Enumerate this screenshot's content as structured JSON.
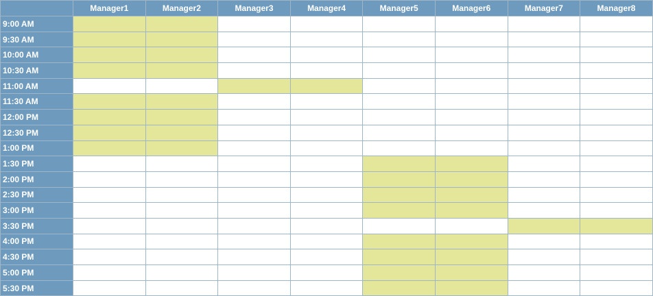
{
  "colors": {
    "header_bg": "#6e9bbd",
    "header_text": "#ffffff",
    "booked": "#e4e799",
    "free": "#ffffff",
    "grid": "#9fb6c8"
  },
  "schedule": {
    "managers": [
      "Manager1",
      "Manager2",
      "Manager3",
      "Manager4",
      "Manager5",
      "Manager6",
      "Manager7",
      "Manager8"
    ],
    "times": [
      "9:00 AM",
      "9:30 AM",
      "10:00 AM",
      "10:30 AM",
      "11:00 AM",
      "11:30 AM",
      "12:00 PM",
      "12:30 PM",
      "1:00 PM",
      "1:30 PM",
      "2:00 PM",
      "2:30 PM",
      "3:00 PM",
      "3:30 PM",
      "4:00 PM",
      "4:30 PM",
      "5:00 PM",
      "5:30 PM"
    ],
    "booked": [
      [
        1,
        1,
        0,
        0,
        0,
        0,
        0,
        0
      ],
      [
        1,
        1,
        0,
        0,
        0,
        0,
        0,
        0
      ],
      [
        1,
        1,
        0,
        0,
        0,
        0,
        0,
        0
      ],
      [
        1,
        1,
        0,
        0,
        0,
        0,
        0,
        0
      ],
      [
        0,
        0,
        1,
        1,
        0,
        0,
        0,
        0
      ],
      [
        1,
        1,
        0,
        0,
        0,
        0,
        0,
        0
      ],
      [
        1,
        1,
        0,
        0,
        0,
        0,
        0,
        0
      ],
      [
        1,
        1,
        0,
        0,
        0,
        0,
        0,
        0
      ],
      [
        1,
        1,
        0,
        0,
        0,
        0,
        0,
        0
      ],
      [
        0,
        0,
        0,
        0,
        1,
        1,
        0,
        0
      ],
      [
        0,
        0,
        0,
        0,
        1,
        1,
        0,
        0
      ],
      [
        0,
        0,
        0,
        0,
        1,
        1,
        0,
        0
      ],
      [
        0,
        0,
        0,
        0,
        1,
        1,
        0,
        0
      ],
      [
        0,
        0,
        0,
        0,
        0,
        0,
        1,
        1
      ],
      [
        0,
        0,
        0,
        0,
        1,
        1,
        0,
        0
      ],
      [
        0,
        0,
        0,
        0,
        1,
        1,
        0,
        0
      ],
      [
        0,
        0,
        0,
        0,
        1,
        1,
        0,
        0
      ],
      [
        0,
        0,
        0,
        0,
        1,
        1,
        0,
        0
      ]
    ]
  }
}
